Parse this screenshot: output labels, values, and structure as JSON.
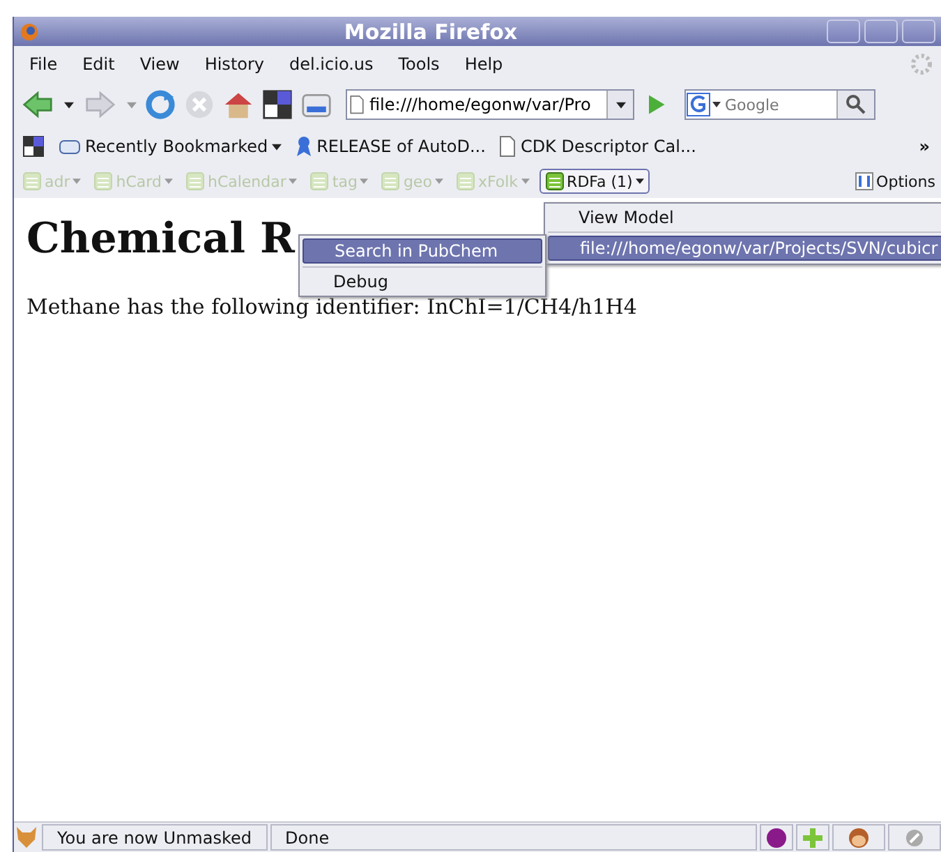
{
  "window": {
    "title": "Mozilla Firefox"
  },
  "menubar": [
    {
      "label": "File"
    },
    {
      "label": "Edit"
    },
    {
      "label": "View"
    },
    {
      "label": "History"
    },
    {
      "label": "del.icio.us"
    },
    {
      "label": "Tools"
    },
    {
      "label": "Help"
    }
  ],
  "address": {
    "value": "file:///home/egonw/var/Pro"
  },
  "search": {
    "placeholder": "Google"
  },
  "bookmarks": [
    {
      "label": "Recently Bookmarked",
      "kind": "folder"
    },
    {
      "label": "RELEASE of AutoD...",
      "kind": "ribbon"
    },
    {
      "label": "CDK Descriptor Cal...",
      "kind": "page"
    }
  ],
  "bookmarks_more": "»",
  "microformats": [
    {
      "label": "adr",
      "disabled": true
    },
    {
      "label": "hCard",
      "disabled": true
    },
    {
      "label": "hCalendar",
      "disabled": true
    },
    {
      "label": "tag",
      "disabled": true
    },
    {
      "label": "geo",
      "disabled": true
    },
    {
      "label": "xFolk",
      "disabled": true
    },
    {
      "label": "RDFa (1)",
      "disabled": false
    }
  ],
  "options": "Options",
  "page": {
    "heading": "Chemical R",
    "text": "Methane has the following identifier: InChI=1/CH4/h1H4"
  },
  "submenu": [
    {
      "label": "View Model",
      "selected": false
    },
    {
      "label": "file:///home/egonw/var/Projects/SVN/cubicr",
      "selected": true
    }
  ],
  "context_menu": [
    {
      "label": "Search in PubChem",
      "selected": true
    },
    {
      "label": "Debug",
      "selected": false
    }
  ],
  "status_bar": {
    "message": "You are now Unmasked",
    "status": "Done"
  }
}
